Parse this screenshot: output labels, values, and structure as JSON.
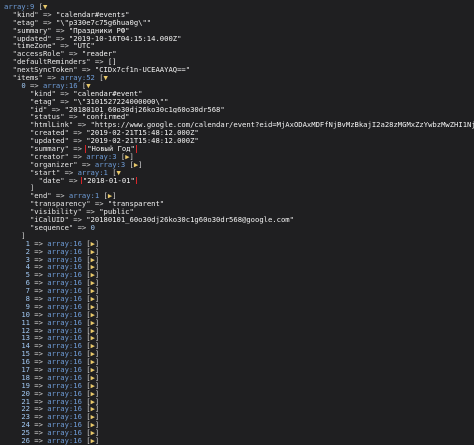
{
  "colors": {
    "background": "#1f1f21",
    "type_blue": "#6f9dd8",
    "toggle_yellow": "#e8c86a",
    "highlight_red": "#d8262a"
  },
  "dump": {
    "root_type": "array:9",
    "fields": [
      {
        "key": "kind",
        "value": "\"calendar#events\""
      },
      {
        "key": "etag",
        "value": "\"\\\"p330e7c75g6hua0g\\\"\""
      },
      {
        "key": "summary",
        "value": "\"Праздники РФ\""
      },
      {
        "key": "updated",
        "value": "\"2019-10-16T04:15:14.000Z\""
      },
      {
        "key": "timeZone",
        "value": "\"UTC\""
      },
      {
        "key": "accessRole",
        "value": "\"reader\""
      },
      {
        "key": "defaultReminders",
        "value": "[]"
      },
      {
        "key": "nextSyncToken",
        "value": "\"CIDx7cf1n-UCEAAYAQ==\""
      }
    ],
    "items_key": "items",
    "items_type": "array:52",
    "item0": {
      "index": "0",
      "type": "array:16",
      "fields": [
        {
          "key": "kind",
          "value": "\"calendar#event\""
        },
        {
          "key": "etag",
          "value": "\"\\\"3101527224000000\\\"\""
        },
        {
          "key": "id",
          "value": "\"20180101_60o30dj26ko30c1g60o30dr568\""
        },
        {
          "key": "status",
          "value": "\"confirmed\""
        },
        {
          "key": "htmlLink",
          "value": "\"https://www.google.com/calendar/event?eid=MjAxODAxMDFfNjBvMzBkajI2a28zMGMxZzYwbzMwZHI1NjggcnVzc2lhbl"
        },
        {
          "key": "created",
          "value": "\"2019-02-21T15:48:12.000Z\""
        },
        {
          "key": "updated",
          "value": "\"2019-02-21T15:48:12.000Z\""
        }
      ],
      "summary_key": "summary",
      "summary_value": "\"Новый Год\"",
      "creator_key": "creator",
      "creator_type": "array:3",
      "organizer_key": "organizer",
      "organizer_type": "array:3",
      "start_key": "start",
      "start_type": "array:1",
      "date_key": "date",
      "date_value": "\"2018-01-01\"",
      "end_key": "end",
      "end_type": "array:1",
      "fields_after": [
        {
          "key": "transparency",
          "value": "\"transparent\""
        },
        {
          "key": "visibility",
          "value": "\"public\""
        },
        {
          "key": "iCalUID",
          "value": "\"20180101_60o30dj26ko30c1g60o30dr568@google.com\""
        },
        {
          "key": "sequence",
          "value": "0"
        }
      ]
    },
    "collapsed_items": [
      {
        "index": "1",
        "type": "array:16"
      },
      {
        "index": "2",
        "type": "array:16"
      },
      {
        "index": "3",
        "type": "array:16"
      },
      {
        "index": "4",
        "type": "array:16"
      },
      {
        "index": "5",
        "type": "array:16"
      },
      {
        "index": "6",
        "type": "array:16"
      },
      {
        "index": "7",
        "type": "array:16"
      },
      {
        "index": "8",
        "type": "array:16"
      },
      {
        "index": "9",
        "type": "array:16"
      },
      {
        "index": "10",
        "type": "array:16"
      },
      {
        "index": "11",
        "type": "array:16"
      },
      {
        "index": "12",
        "type": "array:16"
      },
      {
        "index": "13",
        "type": "array:16"
      },
      {
        "index": "14",
        "type": "array:16"
      },
      {
        "index": "15",
        "type": "array:16"
      },
      {
        "index": "16",
        "type": "array:16"
      },
      {
        "index": "17",
        "type": "array:16"
      },
      {
        "index": "18",
        "type": "array:16"
      },
      {
        "index": "19",
        "type": "array:16"
      },
      {
        "index": "20",
        "type": "array:16"
      },
      {
        "index": "21",
        "type": "array:16"
      },
      {
        "index": "22",
        "type": "array:16"
      },
      {
        "index": "23",
        "type": "array:16"
      },
      {
        "index": "24",
        "type": "array:16"
      },
      {
        "index": "25",
        "type": "array:16"
      },
      {
        "index": "26",
        "type": "array:16"
      }
    ]
  }
}
